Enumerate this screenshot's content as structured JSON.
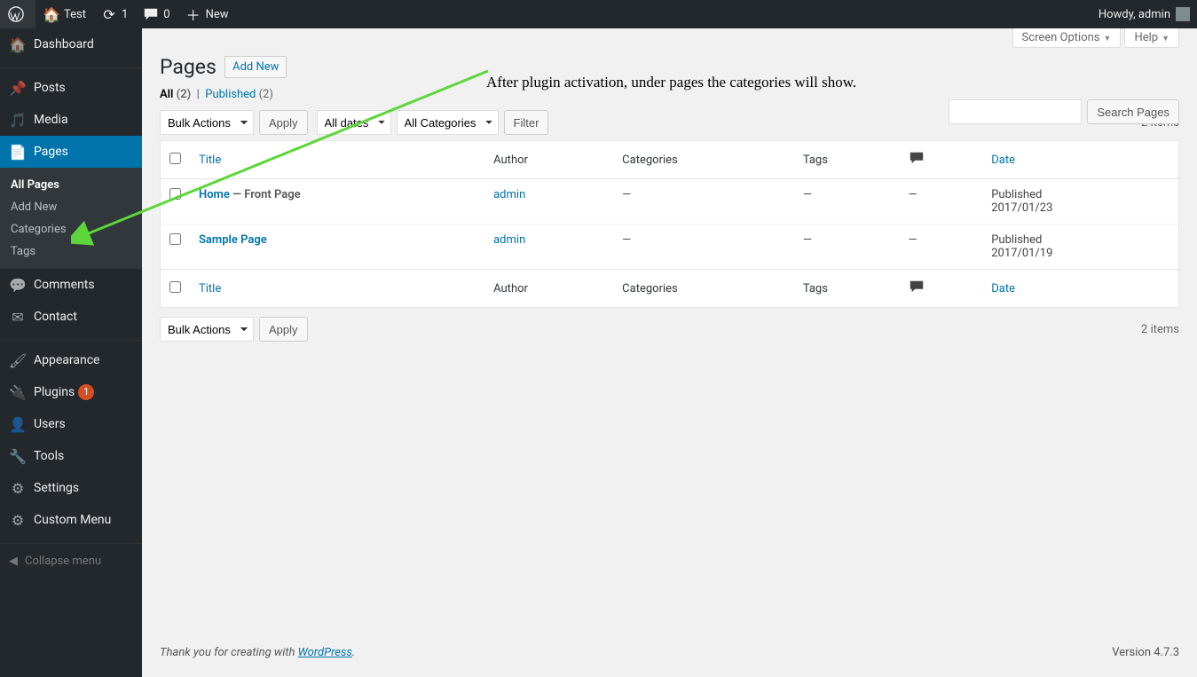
{
  "adminbar": {
    "site_name": "Test",
    "updates": "1",
    "comments": "0",
    "new": "New",
    "howdy": "Howdy, admin"
  },
  "menu": {
    "dashboard": "Dashboard",
    "posts": "Posts",
    "media": "Media",
    "pages": "Pages",
    "submenu": {
      "all_pages": "All Pages",
      "add_new": "Add New",
      "categories": "Categories",
      "tags": "Tags"
    },
    "comments": "Comments",
    "contact": "Contact",
    "appearance": "Appearance",
    "plugins": "Plugins",
    "plugins_badge": "1",
    "users": "Users",
    "tools": "Tools",
    "settings": "Settings",
    "custom_menu": "Custom Menu",
    "collapse": "Collapse menu"
  },
  "screen_meta": {
    "screen_options": "Screen Options",
    "help": "Help"
  },
  "header": {
    "title": "Pages",
    "add_new": "Add New"
  },
  "subsubsub": {
    "all": "All",
    "all_count": "(2)",
    "published": "Published",
    "published_count": "(2)"
  },
  "filters": {
    "bulk_actions": "Bulk Actions",
    "apply": "Apply",
    "all_dates": "All dates",
    "all_categories": "All Categories",
    "filter": "Filter",
    "items": "2 items",
    "search_pages": "Search Pages"
  },
  "columns": {
    "title": "Title",
    "author": "Author",
    "categories": "Categories",
    "tags": "Tags",
    "date": "Date"
  },
  "rows": [
    {
      "title": "Home",
      "state": "— Front Page",
      "author": "admin",
      "categories": "—",
      "tags": "—",
      "comments": "—",
      "date_status": "Published",
      "date": "2017/01/23"
    },
    {
      "title": "Sample Page",
      "state": "",
      "author": "admin",
      "categories": "—",
      "tags": "—",
      "comments": "—",
      "date_status": "Published",
      "date": "2017/01/19"
    }
  ],
  "footer": {
    "thanks_pre": "Thank you for creating with ",
    "wp": "WordPress",
    "version": "Version 4.7.3"
  },
  "annotation": "After plugin activation, under pages the categories will show."
}
